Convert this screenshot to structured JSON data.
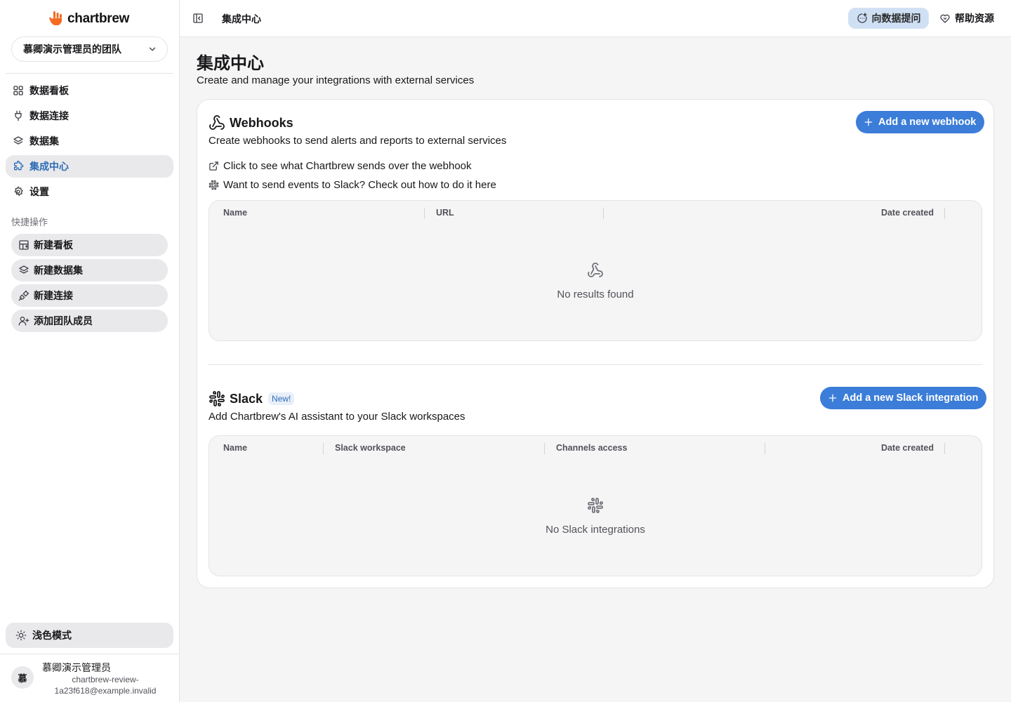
{
  "app": {
    "logo_text": "chartbrew"
  },
  "sidebar": {
    "team_name": "慕卿演示管理员的团队",
    "nav": [
      {
        "label": "数据看板",
        "icon": "grid-icon"
      },
      {
        "label": "数据连接",
        "icon": "plug-icon"
      },
      {
        "label": "数据集",
        "icon": "layers-icon"
      },
      {
        "label": "集成中心",
        "icon": "puzzle-icon",
        "active": true
      },
      {
        "label": "设置",
        "icon": "gear-icon"
      }
    ],
    "quick_label": "快捷操作",
    "quick": [
      {
        "label": "新建看板",
        "icon": "board-add-icon"
      },
      {
        "label": "新建数据集",
        "icon": "layers-icon"
      },
      {
        "label": "新建连接",
        "icon": "plug-connect-icon"
      },
      {
        "label": "添加团队成员",
        "icon": "user-add-icon"
      }
    ],
    "theme_label": "浅色模式",
    "user": {
      "initial": "慕",
      "name": "慕卿演示管理员",
      "email": "chartbrew-review-1a23f618@example.invalid"
    }
  },
  "topbar": {
    "breadcrumb": "集成中心",
    "ask_label": "向数据提问",
    "help_label": "帮助资源"
  },
  "main": {
    "title": "集成中心",
    "subtitle": "Create and manage your integrations with external services",
    "webhooks": {
      "title": "Webhooks",
      "description": "Create webhooks to send alerts and reports to external services",
      "add_label": "Add a new webhook",
      "link1": "Click to see what Chartbrew sends over the webhook",
      "link2": "Want to send events to Slack? Check out how to do it here",
      "columns": [
        "Name",
        "URL",
        "Date created"
      ],
      "empty": "No results found"
    },
    "slack": {
      "title": "Slack",
      "badge": "New!",
      "description": "Add Chartbrew's AI assistant to your Slack workspaces",
      "add_label": "Add a new Slack integration",
      "columns": [
        "Name",
        "Slack workspace",
        "Channels access",
        "Date created"
      ],
      "empty": "No Slack integrations"
    }
  },
  "colors": {
    "accent": "#3b7dd8",
    "active_nav_text": "#2f6db5",
    "logo_orange": "#f26b21"
  }
}
